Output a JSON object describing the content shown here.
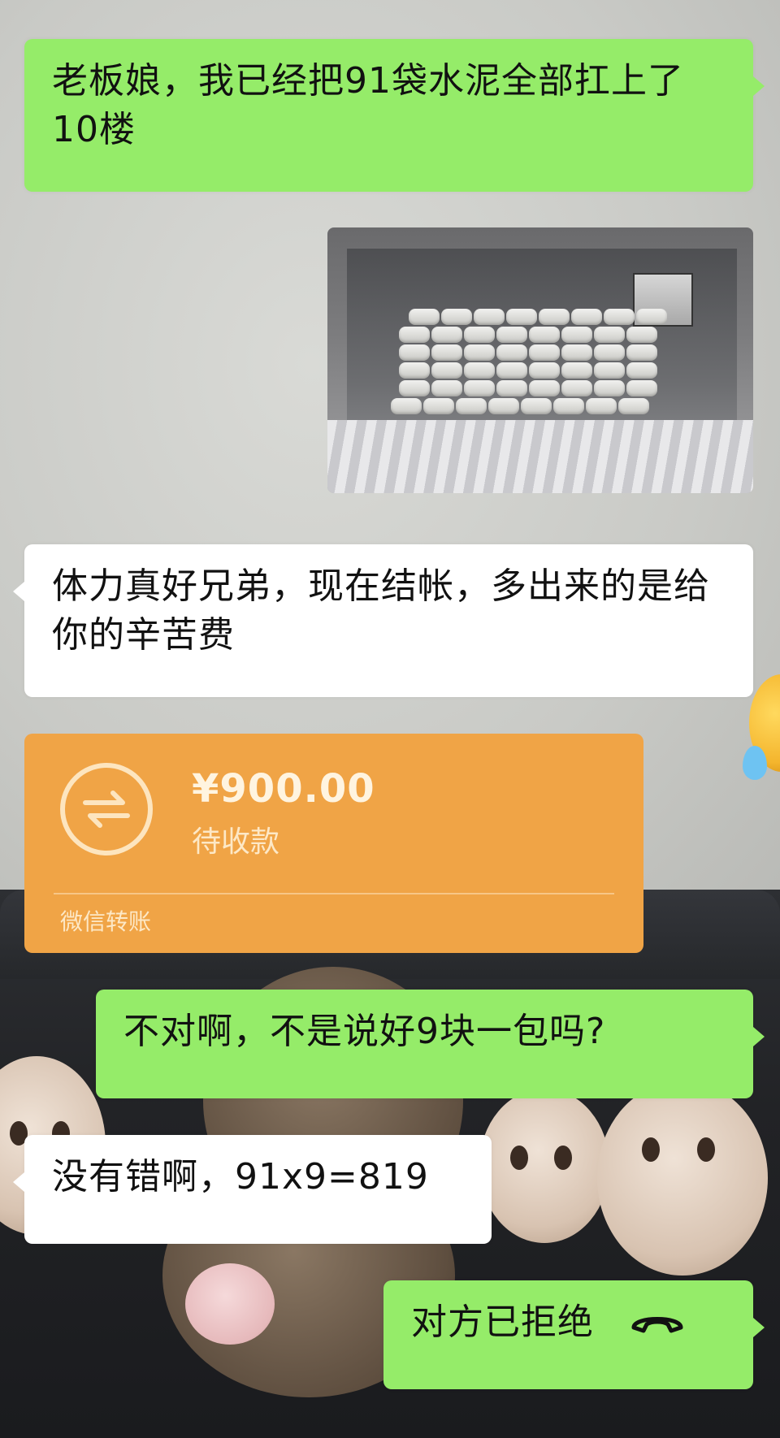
{
  "messages": [
    {
      "id": "m1",
      "side": "right",
      "type": "text",
      "text": "老板娘，我已经把91袋水泥全部扛上了10楼"
    },
    {
      "id": "m2",
      "side": "right",
      "type": "image",
      "icon": "cement-bags-photo"
    },
    {
      "id": "m3",
      "side": "left",
      "type": "text",
      "text": "体力真好兄弟，现在结帐，多出来的是给你的辛苦费"
    },
    {
      "id": "m4",
      "side": "left",
      "type": "transfer",
      "amount": "¥900.00",
      "status": "待收款",
      "footer": "微信转账"
    },
    {
      "id": "m5",
      "side": "right",
      "type": "text",
      "text": "不对啊，不是说好9块一包吗?"
    },
    {
      "id": "m6",
      "side": "left",
      "type": "text",
      "text": "没有错啊，91x9=819"
    },
    {
      "id": "m7",
      "side": "right",
      "type": "call",
      "text": "对方已拒绝",
      "icon": "hang-up-icon"
    }
  ],
  "colors": {
    "sent_bubble": "#95ec69",
    "received_bubble": "#ffffff",
    "transfer_card": "#f0a446"
  }
}
